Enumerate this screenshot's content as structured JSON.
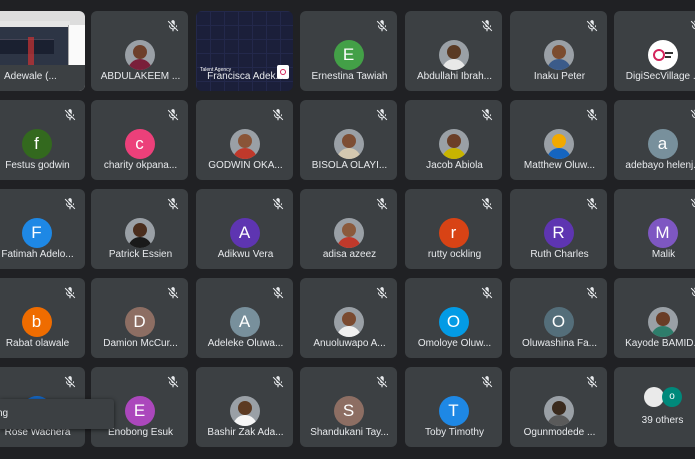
{
  "participants": [
    [
      {
        "name": "Adewale (...",
        "kind": "desktop"
      },
      {
        "name": "ABDULAKEEM ...",
        "kind": "photo",
        "face": "#6d3f2a",
        "cloth": "#7a1f3a"
      },
      {
        "name": "Francisca Adek...",
        "kind": "screen",
        "screen_text": "Talent Agency"
      },
      {
        "name": "Ernestina Tawiah",
        "kind": "initial",
        "initial": "E",
        "color": "#43a047"
      },
      {
        "name": "Abdullahi Ibrah...",
        "kind": "photo",
        "face": "#5a3a24",
        "cloth": "#e8e8e8"
      },
      {
        "name": "Inaku Peter",
        "kind": "photo",
        "face": "#7b4c2f",
        "cloth": "#3b5b8a"
      },
      {
        "name": "DigiSecVillage ...",
        "kind": "logo"
      }
    ],
    [
      {
        "name": "Festus godwin",
        "kind": "initial",
        "initial": "f",
        "color": "#33691e"
      },
      {
        "name": "charity okpana...",
        "kind": "initial",
        "initial": "c",
        "color": "#ec407a"
      },
      {
        "name": "GODWIN OKA...",
        "kind": "photo",
        "face": "#8a5538",
        "cloth": "#c0392b"
      },
      {
        "name": "BISOLA OLAYI...",
        "kind": "photo",
        "face": "#7d4e34",
        "cloth": "#d4c8b0"
      },
      {
        "name": "Jacob Abiola",
        "kind": "photo",
        "face": "#6b3f28",
        "cloth": "#c7b400"
      },
      {
        "name": "Matthew Oluw...",
        "kind": "photo",
        "face": "#f2a900",
        "cloth": "#1565c0"
      },
      {
        "name": "adebayo helenj...",
        "kind": "initial",
        "initial": "a",
        "color": "#78909c"
      }
    ],
    [
      {
        "name": "Fatimah Adelo...",
        "kind": "initial",
        "initial": "F",
        "color": "#1e88e5"
      },
      {
        "name": "Patrick Essien",
        "kind": "photo",
        "face": "#4a2d1d",
        "cloth": "#1a1a1a"
      },
      {
        "name": "Adikwu Vera",
        "kind": "initial",
        "initial": "A",
        "color": "#5e35b1"
      },
      {
        "name": "adisa azeez",
        "kind": "photo",
        "face": "#8b5a3c",
        "cloth": "#c0392b"
      },
      {
        "name": "rutty ockling",
        "kind": "initial",
        "initial": "r",
        "color": "#d84315"
      },
      {
        "name": "Ruth Charles",
        "kind": "initial",
        "initial": "R",
        "color": "#5e35b1"
      },
      {
        "name": "Malik",
        "kind": "initial",
        "initial": "M",
        "color": "#7e57c2"
      }
    ],
    [
      {
        "name": "Rabat olawale",
        "kind": "initial",
        "initial": "b",
        "color": "#ef6c00"
      },
      {
        "name": "Damion McCur...",
        "kind": "initial",
        "initial": "D",
        "color": "#8d6e63"
      },
      {
        "name": "Adeleke Oluwa...",
        "kind": "initial",
        "initial": "A",
        "color": "#78909c"
      },
      {
        "name": "Anuoluwapo A...",
        "kind": "photo",
        "face": "#7a4a30",
        "cloth": "#f0f0f0"
      },
      {
        "name": "Omoloye Oluw...",
        "kind": "initial",
        "initial": "O",
        "color": "#039be5"
      },
      {
        "name": "Oluwashina Fa...",
        "kind": "initial",
        "initial": "O",
        "color": "#546e7a"
      },
      {
        "name": "Kayode BAMID...",
        "kind": "photo",
        "face": "#6a3d26",
        "cloth": "#2e7d6b"
      }
    ],
    [
      {
        "name": "Rose Wachera",
        "kind": "initial",
        "initial": "R",
        "color": "#1565c0"
      },
      {
        "name": "Enobong Esuk",
        "kind": "initial",
        "initial": "E",
        "color": "#ab47bc"
      },
      {
        "name": "Bashir Zak Ada...",
        "kind": "photo",
        "face": "#5c3a22",
        "cloth": "#f5f5f5"
      },
      {
        "name": "Shandukani Tay...",
        "kind": "initial",
        "initial": "S",
        "color": "#8d6e63"
      },
      {
        "name": "Toby Timothy",
        "kind": "initial",
        "initial": "T",
        "color": "#1e88e5"
      },
      {
        "name": "Ogunmodede ...",
        "kind": "photo",
        "face": "#3a2a1d",
        "cloth": "#5a5a5a"
      },
      {
        "name": "39 others",
        "kind": "others",
        "initial": "o",
        "color": "#00897b"
      }
    ]
  ],
  "toast": {
    "text": "ng"
  },
  "others_count": "39 others"
}
